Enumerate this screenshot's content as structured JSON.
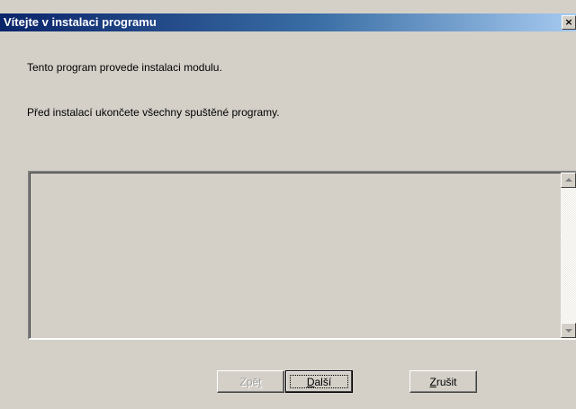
{
  "window": {
    "title": "Vítejte v instalaci programu",
    "close_glyph": "×"
  },
  "content": {
    "line1": "Tento program provede instalaci modulu.",
    "line2": "Před instalací ukončete všechny spuštěné programy."
  },
  "buttons": {
    "back": {
      "prefix": "Zpě",
      "accel": "t",
      "suffix": "",
      "enabled": false
    },
    "next": {
      "prefix": "",
      "accel": "D",
      "suffix": "alší",
      "enabled": true,
      "focused": true
    },
    "cancel": {
      "prefix": "",
      "accel": "Z",
      "suffix": "rušit",
      "enabled": true
    }
  },
  "colors": {
    "titlebar_start": "#0a246a",
    "titlebar_end": "#a6caf0",
    "face": "#d4d0c8"
  }
}
